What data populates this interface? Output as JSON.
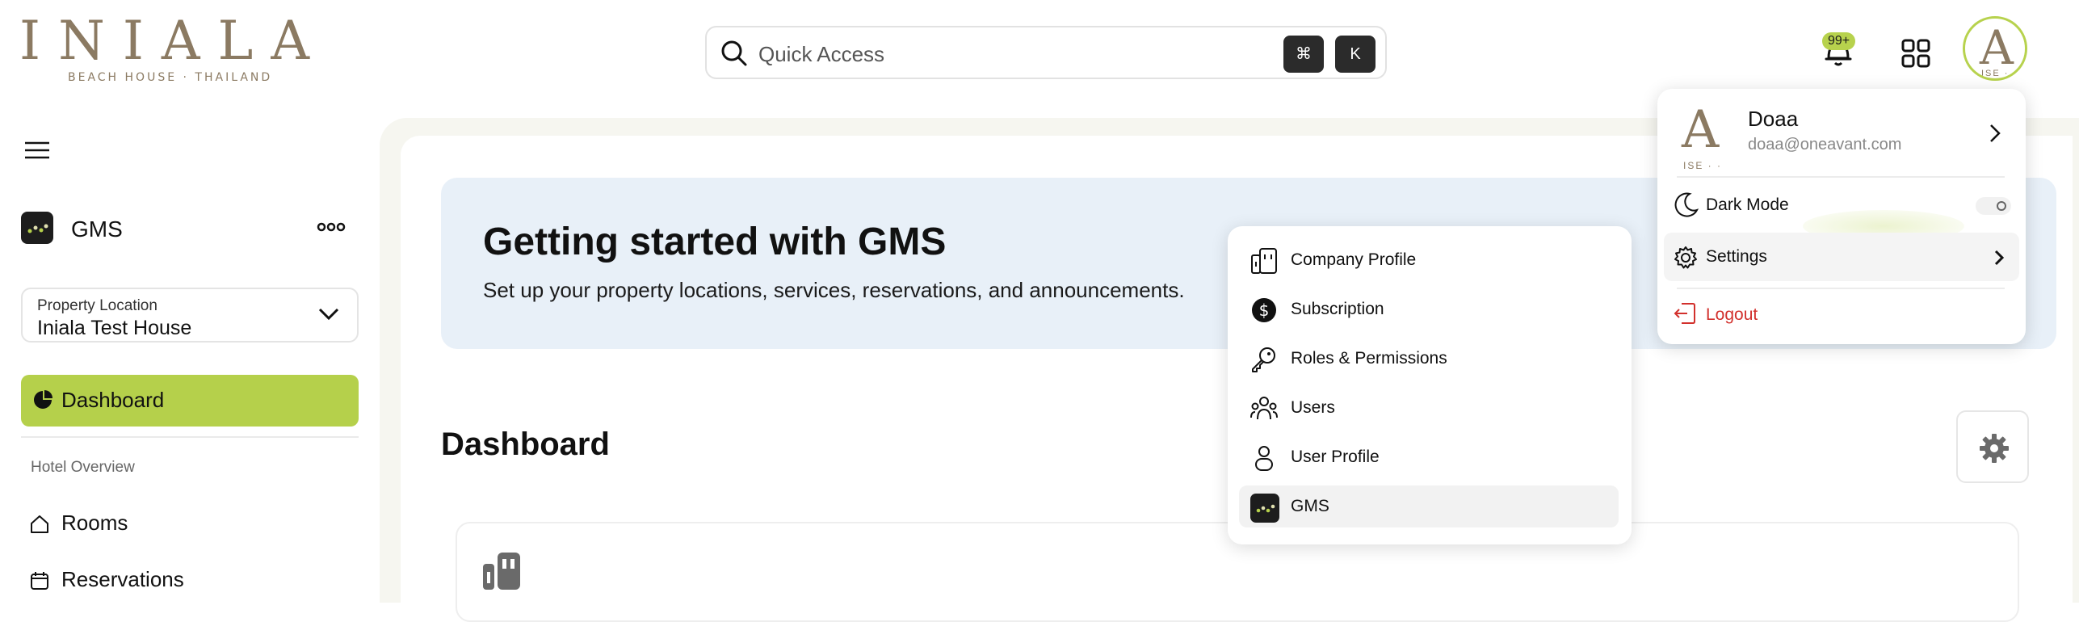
{
  "brand": {
    "name": "INIALA",
    "tagline": "BEACH HOUSE · THAILAND",
    "color": "#8b7a62",
    "accent": "#b5d04b"
  },
  "header": {
    "search_placeholder": "Quick Access",
    "shortcut_cmd": "⌘",
    "shortcut_key": "K",
    "notification_badge": "99+",
    "avatar_letter": "A",
    "avatar_sub": "ISE · ·"
  },
  "sidebar": {
    "app_name": "GMS",
    "property": {
      "label": "Property Location",
      "value": "Iniala Test House"
    },
    "active_item": "Dashboard",
    "section": "Hotel Overview",
    "items": [
      {
        "label": "Rooms",
        "icon": "home-icon"
      },
      {
        "label": "Reservations",
        "icon": "calendar-icon"
      }
    ]
  },
  "main": {
    "hero_title": "Getting started with GMS",
    "hero_subtitle": "Set up your property locations, services, reservations, and announcements.",
    "section_title": "Dashboard"
  },
  "settings_menu": {
    "items": [
      {
        "label": "Company Profile",
        "icon": "building-icon"
      },
      {
        "label": "Subscription",
        "icon": "dollar-icon"
      },
      {
        "label": "Roles & Permissions",
        "icon": "key-icon"
      },
      {
        "label": "Users",
        "icon": "users-icon"
      },
      {
        "label": "User Profile",
        "icon": "user-icon"
      },
      {
        "label": "GMS",
        "icon": "gms-icon"
      }
    ],
    "active": "GMS"
  },
  "profile_panel": {
    "avatar_letter": "A",
    "avatar_sub": "ISE · ·",
    "name": "Doaa",
    "email": "doaa@oneavant.com",
    "dark_mode_label": "Dark Mode",
    "dark_mode_on": false,
    "settings_label": "Settings",
    "logout_label": "Logout",
    "logout_color": "#d2302c"
  }
}
